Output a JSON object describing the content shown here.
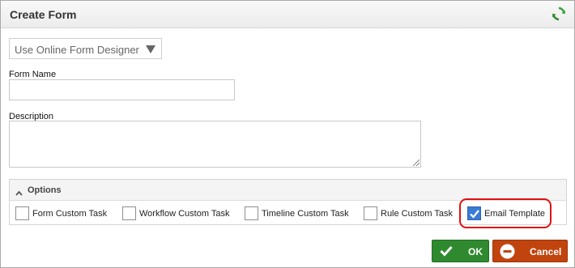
{
  "dialog": {
    "title": "Create Form"
  },
  "designer_select": {
    "value": "Use Online Form Designer"
  },
  "form_name": {
    "label": "Form Name",
    "value": ""
  },
  "description": {
    "label": "Description",
    "value": ""
  },
  "options": {
    "title": "Options",
    "items": [
      {
        "label": "Form Custom Task",
        "checked": false
      },
      {
        "label": "Workflow Custom Task",
        "checked": false
      },
      {
        "label": "Timeline Custom Task",
        "checked": false
      },
      {
        "label": "Rule Custom Task",
        "checked": false
      },
      {
        "label": "Email Template",
        "checked": true
      }
    ]
  },
  "buttons": {
    "ok_label": "OK",
    "cancel_label": "Cancel"
  },
  "colors": {
    "ok": "#2f8a2f",
    "cancel": "#c1440e",
    "checkbox_checked": "#3a7bd5",
    "highlight": "#e01010"
  },
  "icons": {
    "refresh": "refresh-icon",
    "options_toggle": "chevron-up-icon",
    "ok": "check-icon",
    "cancel": "minus-circle-icon"
  }
}
